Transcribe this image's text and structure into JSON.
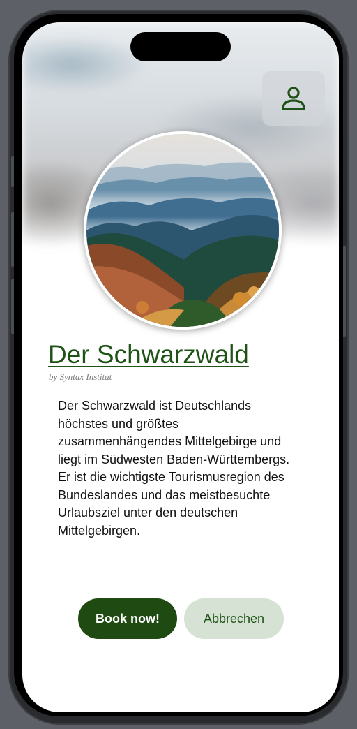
{
  "header": {
    "profile_icon": "person-icon"
  },
  "hero": {
    "image_description": "misty-mountain-forest"
  },
  "article": {
    "title": "Der Schwarzwald",
    "byline": "by Syntax Institut",
    "description": "Der Schwarzwald ist Deutschlands höchstes und größtes zusammenhängendes Mittelgebirge und liegt im Südwesten Baden-Württembergs. Er ist die wichtigste Tourismusregion des Bundeslandes und das meistbesuchte Urlaubsziel unter den deutschen Mittelgebirgen."
  },
  "actions": {
    "book_label": "Book now!",
    "cancel_label": "Abbrechen"
  },
  "colors": {
    "accent": "#1f4a11",
    "title": "#1f5216",
    "secondary_button": "#d6e2d4"
  }
}
